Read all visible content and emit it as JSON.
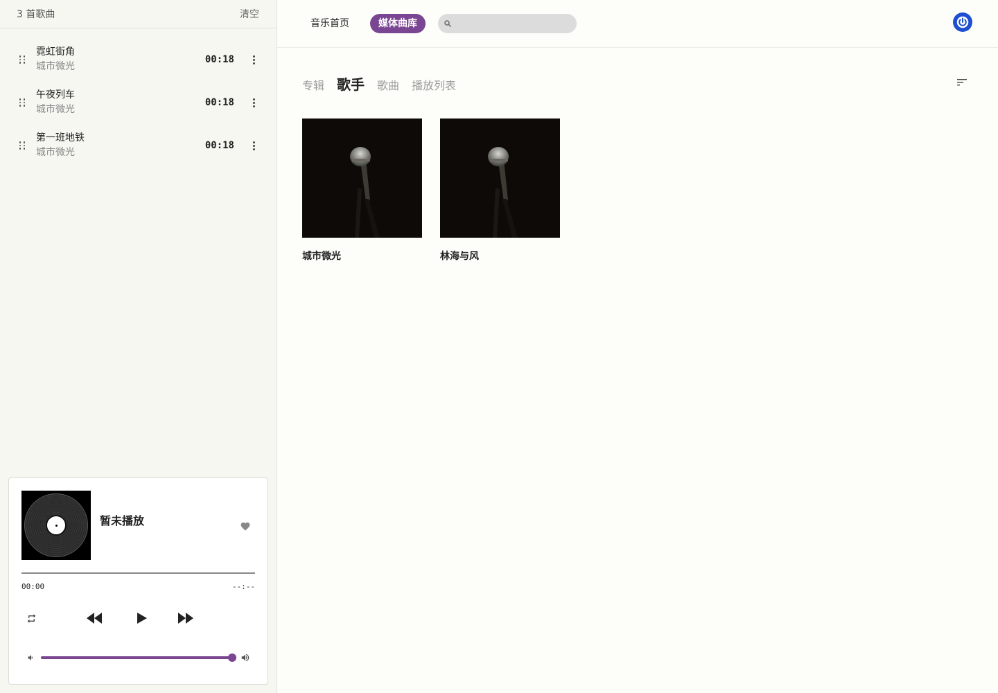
{
  "queue": {
    "count_label": "3 首歌曲",
    "clear_label": "清空",
    "items": [
      {
        "title": "霓虹街角",
        "artist": "城市微光",
        "duration": "00:18"
      },
      {
        "title": "午夜列车",
        "artist": "城市微光",
        "duration": "00:18"
      },
      {
        "title": "第一班地铁",
        "artist": "城市微光",
        "duration": "00:18"
      }
    ]
  },
  "player": {
    "now_playing": "暂未播放",
    "current_time": "00:00",
    "total_time": "--:--",
    "progress": 0,
    "volume": 1.0
  },
  "nav": {
    "home_label": "音乐首页",
    "library_label": "媒体曲库",
    "search_placeholder": ""
  },
  "tabs": [
    {
      "label": "专辑",
      "active": false
    },
    {
      "label": "歌手",
      "active": true
    },
    {
      "label": "歌曲",
      "active": false
    },
    {
      "label": "播放列表",
      "active": false
    }
  ],
  "artists": [
    {
      "name": "城市微光"
    },
    {
      "name": "林海与风"
    }
  ],
  "colors": {
    "accent": "#7a4592",
    "power_button": "#1f4fd1",
    "background": "#fdfdf9",
    "sidebar": "#f7f7f2"
  },
  "icons": [
    "drag-handle-icon",
    "more-vertical-icon",
    "heart-icon",
    "repeat-icon",
    "rewind-icon",
    "play-icon",
    "fast-forward-icon",
    "volume-low-icon",
    "volume-high-icon",
    "search-icon",
    "power-icon",
    "sort-icon",
    "microphone-image"
  ]
}
